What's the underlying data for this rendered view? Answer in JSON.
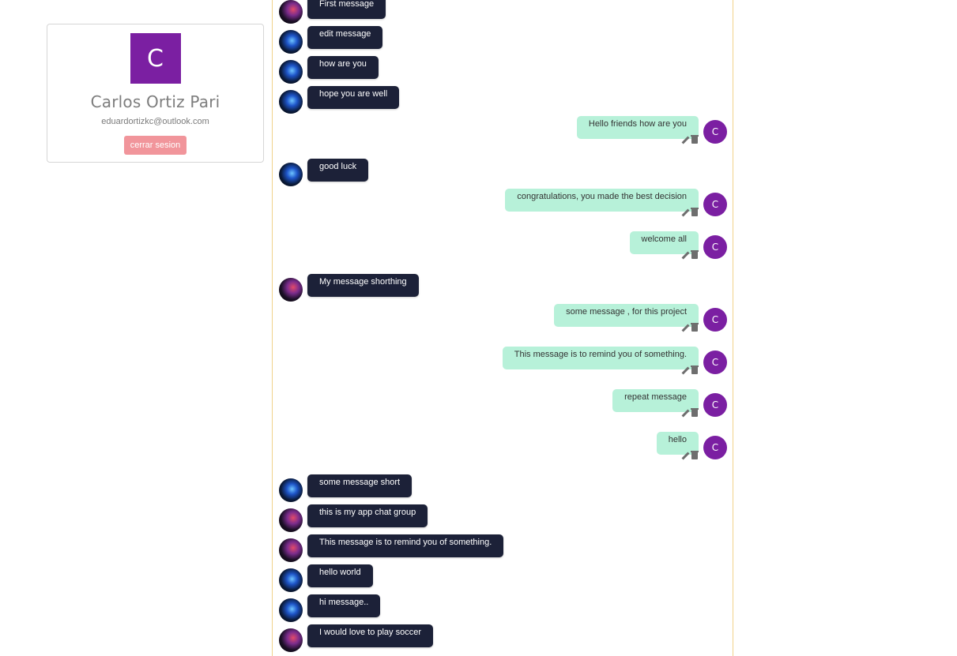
{
  "profile": {
    "avatar_letter": "C",
    "name": "Carlos Ortiz Pari",
    "email": "eduardortizkc@outlook.com",
    "logout_label": "cerrar sesion"
  },
  "colors": {
    "avatar": "#7b1fa2",
    "own_bubble": "#b7f1d9",
    "other_bubble": "#1c2138",
    "logout_button": "#f1959b",
    "panel_border": "#f1d28a"
  },
  "messages": [
    {
      "text": "First message",
      "own": false,
      "avatar": "avatar-a"
    },
    {
      "text": "edit message",
      "own": false,
      "avatar": "avatar-b"
    },
    {
      "text": "how are you",
      "own": false,
      "avatar": "avatar-b"
    },
    {
      "text": "hope you are well",
      "own": false,
      "avatar": "avatar-b"
    },
    {
      "text": "Hello friends how are you",
      "own": true,
      "avatar_letter": "C"
    },
    {
      "text": "good luck",
      "own": false,
      "avatar": "avatar-b"
    },
    {
      "text": "congratulations, you made the best decision",
      "own": true,
      "avatar_letter": "C"
    },
    {
      "text": "welcome all",
      "own": true,
      "avatar_letter": "C"
    },
    {
      "text": "My message shorthing",
      "own": false,
      "avatar": "avatar-a"
    },
    {
      "text": "some message , for this project",
      "own": true,
      "avatar_letter": "C"
    },
    {
      "text": "This message is to remind you of something.",
      "own": true,
      "avatar_letter": "C"
    },
    {
      "text": "repeat message",
      "own": true,
      "avatar_letter": "C"
    },
    {
      "text": "hello",
      "own": true,
      "avatar_letter": "C"
    },
    {
      "text": "some message short",
      "own": false,
      "avatar": "avatar-b"
    },
    {
      "text": "this is my app chat group",
      "own": false,
      "avatar": "avatar-a"
    },
    {
      "text": "This message is to remind you of something.",
      "own": false,
      "avatar": "avatar-a"
    },
    {
      "text": "hello world",
      "own": false,
      "avatar": "avatar-b"
    },
    {
      "text": "hi message..",
      "own": false,
      "avatar": "avatar-b"
    },
    {
      "text": "I would love to play soccer",
      "own": false,
      "avatar": "avatar-a"
    }
  ]
}
